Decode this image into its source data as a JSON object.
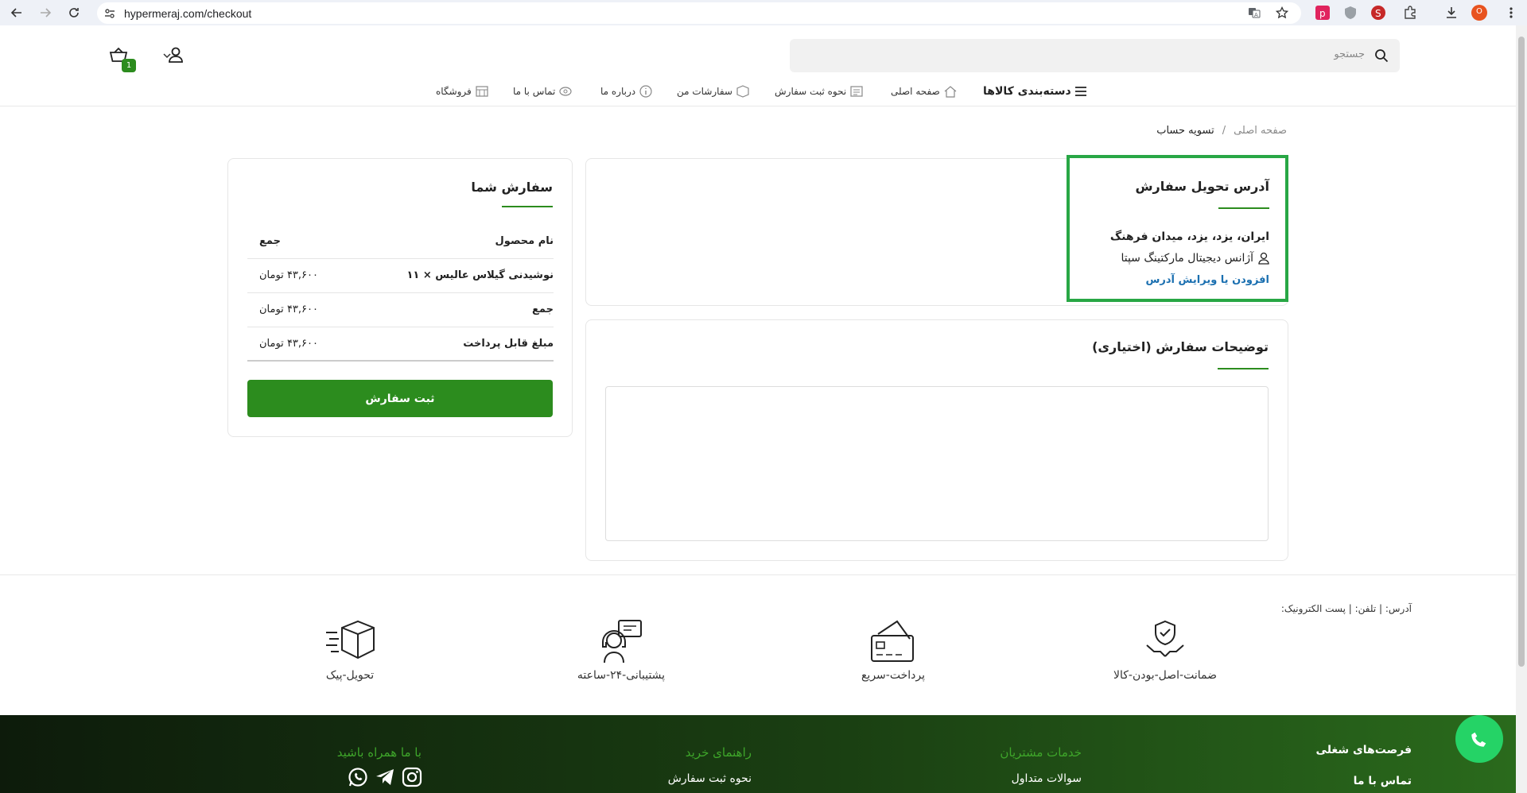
{
  "browser": {
    "url": "hypermeraj.com/checkout",
    "profile_initial": "O"
  },
  "header": {
    "search_placeholder": "جستجو",
    "cart_count": "1",
    "menu": {
      "categories": "دسته‌بندی کالاها",
      "home": "صفحه اصلی",
      "how_to_order": "نحوه ثبت سفارش",
      "my_orders": "سفارشات من",
      "about": "درباره ما",
      "contact": "تماس با ما",
      "shop": "فروشگاه"
    }
  },
  "breadcrumb": {
    "home": "صفحه اصلی",
    "separator": "/",
    "current": "تسویه حساب"
  },
  "address_card": {
    "title": "آدرس تحویل سفارش",
    "address": "ایران، یزد، یزد، میدان فرهنگ",
    "recipient": "آژانس دیجیتال مارکتینگ سپتا",
    "edit_link": "افزودن یا ویرایش آدرس"
  },
  "notes_card": {
    "title": "توضیحات سفارش (اختیاری)",
    "value": ""
  },
  "order_card": {
    "title": "سفارش شما",
    "header": {
      "product": "نام محصول",
      "total": "جمع"
    },
    "rows": [
      {
        "label": "نوشیدنی گیلاس عالیس × ۱۱",
        "value": "۴۳,۶۰۰ تومان"
      },
      {
        "label": "جمع",
        "value": "۴۳,۶۰۰ تومان"
      },
      {
        "label": "مبلغ قابل پرداخت",
        "value": "۴۳,۶۰۰ تومان"
      }
    ],
    "submit_label": "ثبت سفارش"
  },
  "footer": {
    "contact_line": "آدرس: | تلفن: | پست الکترونیک:",
    "features": [
      {
        "label": "ضمانت-اصل-بودن-کالا",
        "icon": "hand-shield-icon"
      },
      {
        "label": "پرداخت-سریع",
        "icon": "card-icon"
      },
      {
        "label": "پشتیبانی-۲۴-ساعته",
        "icon": "support-icon"
      },
      {
        "label": "تحویل-پیک",
        "icon": "fast-box-icon"
      }
    ],
    "links": {
      "jobs": "فرصت‌های شغلی",
      "contact_us": "تماس با ما",
      "customer_services": "خدمات مشتریان",
      "faq": "سوالات متداول",
      "buy_guide": "راهنمای خرید",
      "how_to_order": "نحوه ثبت سفارش",
      "follow_us": "با ما همراه باشید"
    }
  },
  "colors": {
    "accent": "#2c8c1e",
    "highlight_border": "#28a745",
    "link": "#1a6fb0",
    "footer_head": "#3ea52a"
  }
}
